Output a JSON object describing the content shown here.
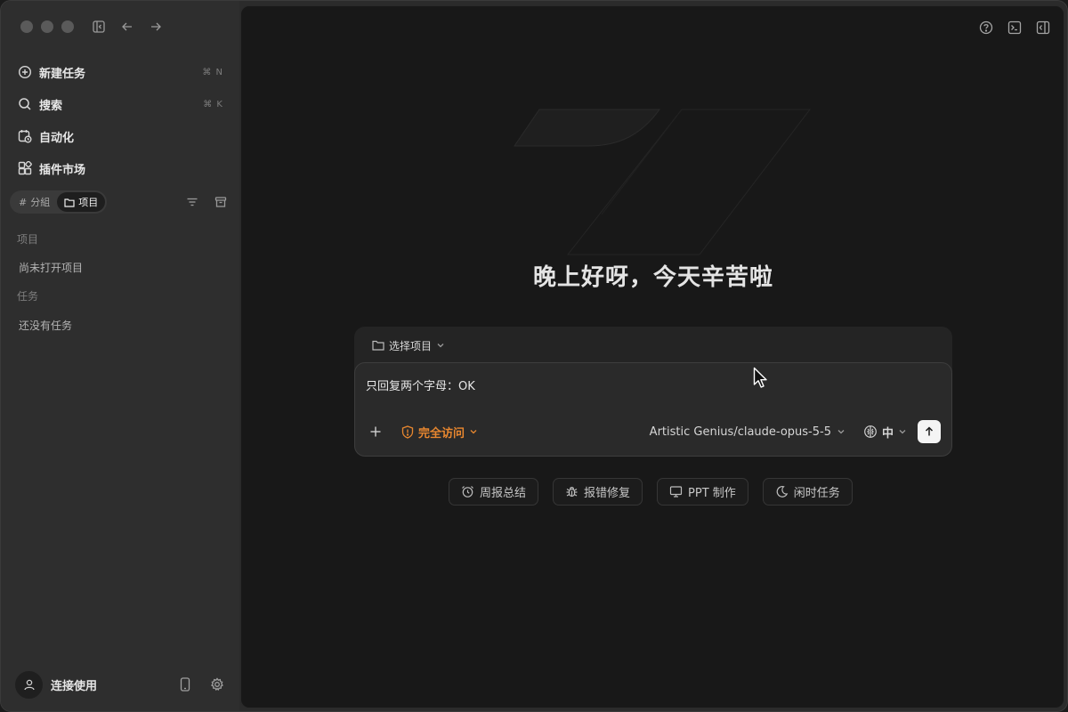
{
  "sidebar": {
    "nav": [
      {
        "label": "新建任务",
        "shortcut": "⌘ N",
        "icon": "new-task-icon"
      },
      {
        "label": "搜索",
        "shortcut": "⌘ K",
        "icon": "search-icon"
      },
      {
        "label": "自动化",
        "shortcut": "",
        "icon": "calendar-clock-icon"
      },
      {
        "label": "插件市场",
        "shortcut": "",
        "icon": "plugins-icon"
      }
    ],
    "segment": {
      "group": "分組",
      "project": "项目",
      "group_icon": "#"
    },
    "sections": {
      "projects_label": "项目",
      "projects_empty": "尚未打开项目",
      "tasks_label": "任务",
      "tasks_empty": "还没有任务"
    },
    "footer": {
      "user_label": "连接使用"
    }
  },
  "main": {
    "greeting": "晚上好呀，今天辛苦啦",
    "composer": {
      "project_select": "选择项目",
      "prompt": "只回复两个字母：OK",
      "access_label": "完全访问",
      "model": "Artistic Genius/claude-opus-5-5",
      "thinking": "中"
    },
    "chips": [
      {
        "label": "周报总结",
        "icon": "alarm-clock-icon"
      },
      {
        "label": "报错修复",
        "icon": "bug-icon"
      },
      {
        "label": "PPT 制作",
        "icon": "presentation-icon"
      },
      {
        "label": "闲时任务",
        "icon": "moon-icon"
      }
    ]
  },
  "colors": {
    "accent": "#e8872f",
    "background": "#181818",
    "sidebar": "#2e2e2e"
  }
}
